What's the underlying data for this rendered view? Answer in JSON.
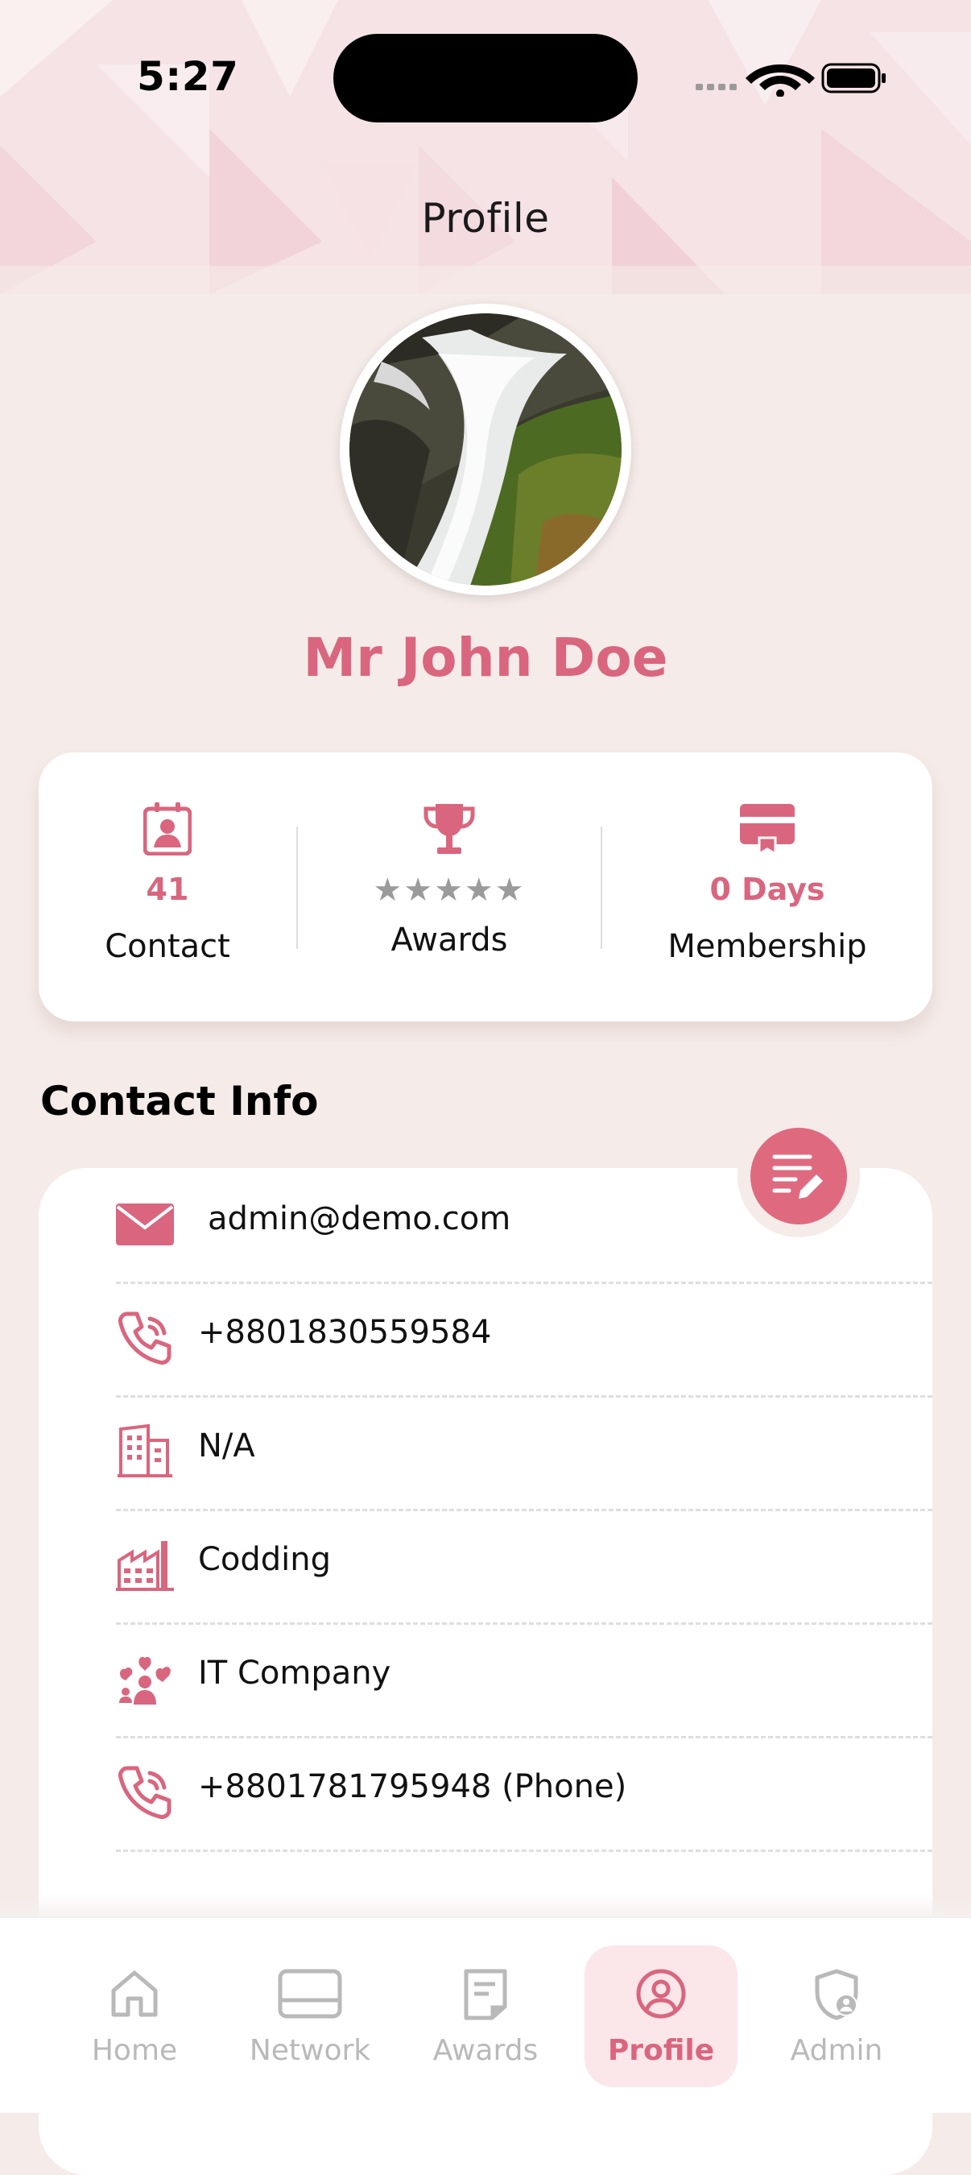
{
  "status_bar": {
    "time": "5:27"
  },
  "header": {
    "title": "Profile"
  },
  "profile": {
    "name": "Mr John Doe"
  },
  "stats": {
    "contact": {
      "value": "41",
      "label": "Contact",
      "icon": "contact-card-icon"
    },
    "awards": {
      "stars": "★★★★★",
      "label": "Awards",
      "icon": "trophy-icon",
      "rating": 0,
      "max_rating": 5
    },
    "membership": {
      "value": "0 Days",
      "label": "Membership",
      "icon": "membership-card-icon"
    }
  },
  "contact_info": {
    "title": "Contact Info",
    "items": [
      {
        "icon": "email-icon",
        "text": "admin@demo.com"
      },
      {
        "icon": "phone-icon",
        "text": "+8801830559584"
      },
      {
        "icon": "building-icon",
        "text": "N/A"
      },
      {
        "icon": "factory-icon",
        "text": "Codding"
      },
      {
        "icon": "team-heart-icon",
        "text": "IT Company"
      },
      {
        "icon": "phone-icon",
        "text": "+8801781795948 (Phone)"
      }
    ]
  },
  "tabs": [
    {
      "label": "Home",
      "icon": "home-icon",
      "active": false
    },
    {
      "label": "Network",
      "icon": "network-icon",
      "active": false
    },
    {
      "label": "Awards",
      "icon": "awards-document-icon",
      "active": false
    },
    {
      "label": "Profile",
      "icon": "profile-icon",
      "active": true
    },
    {
      "label": "Admin",
      "icon": "admin-shield-icon",
      "active": false
    }
  ],
  "colors": {
    "accent": "#D9667E",
    "background": "#F5EBE8",
    "card": "#FFFFFF",
    "inactive_tab": "#B9B9B9",
    "star_inactive": "#9B9B9B"
  }
}
